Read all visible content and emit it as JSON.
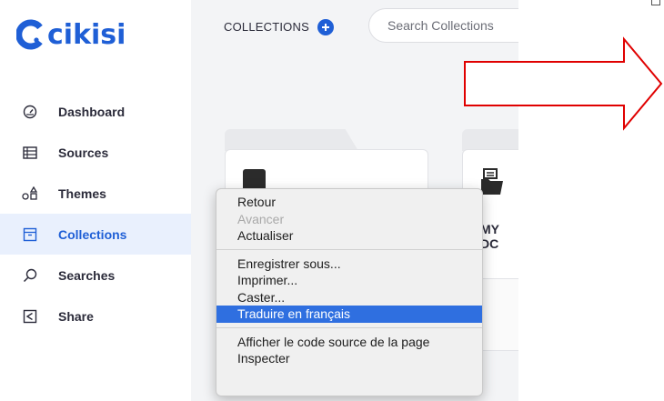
{
  "logo": {
    "text": "cikisi"
  },
  "sidebar": {
    "items": [
      {
        "label": "Dashboard",
        "icon": "dashboard-gauge-icon"
      },
      {
        "label": "Sources",
        "icon": "sources-list-icon"
      },
      {
        "label": "Themes",
        "icon": "themes-shapes-icon"
      },
      {
        "label": "Collections",
        "icon": "collections-box-icon",
        "active": true
      },
      {
        "label": "Searches",
        "icon": "search-icon"
      },
      {
        "label": "Share",
        "icon": "share-icon"
      }
    ]
  },
  "main": {
    "collections_title": "COLLECTIONS",
    "search_placeholder": "Search Collections",
    "card2_label": "MY DC"
  },
  "context_menu": {
    "items": [
      {
        "label": "Retour",
        "disabled": false
      },
      {
        "label": "Avancer",
        "disabled": true
      },
      {
        "label": "Actualiser",
        "disabled": false
      },
      {
        "label": "Enregistrer sous...",
        "disabled": false
      },
      {
        "label": "Imprimer...",
        "disabled": false
      },
      {
        "label": "Caster...",
        "disabled": false
      },
      {
        "label": "Traduire en français",
        "disabled": false,
        "highlighted": true
      },
      {
        "label": "Afficher le code source de la page",
        "disabled": false
      },
      {
        "label": "Inspecter",
        "disabled": false
      }
    ]
  },
  "colors": {
    "brand": "#1f5fd6",
    "active_bg": "#e9f0fd",
    "menu_highlight": "#2f6fe0",
    "arrow": "#e00000"
  }
}
